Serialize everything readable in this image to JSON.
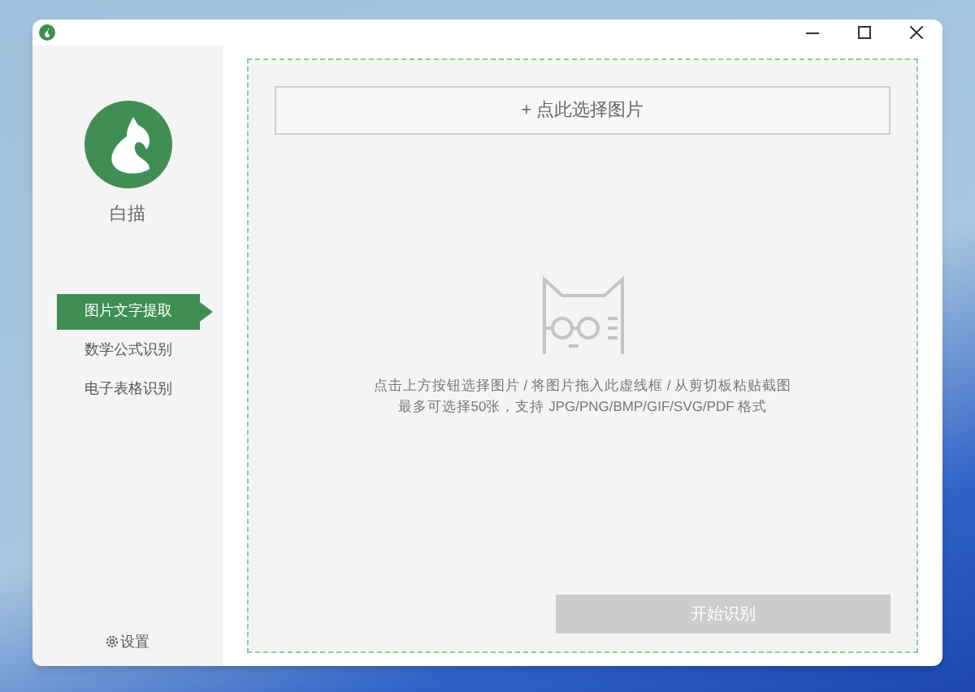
{
  "sidebar": {
    "app_name": "白描",
    "items": [
      {
        "label": "图片文字提取",
        "selected": true
      },
      {
        "label": "数学公式识别",
        "selected": false
      },
      {
        "label": "电子表格识别",
        "selected": false
      }
    ],
    "settings": "设置"
  },
  "main": {
    "select_button": "+ 点此选择图片",
    "hint_lines": [
      "点击上方按钮选择图片 / 将图片拖入此虚线框 / 从剪切板粘贴截图",
      "最多可选择50张，支持 JPG/PNG/BMP/GIF/SVG/PDF 格式"
    ],
    "start_button": {
      "label": "开始识别",
      "disabled": true
    }
  }
}
